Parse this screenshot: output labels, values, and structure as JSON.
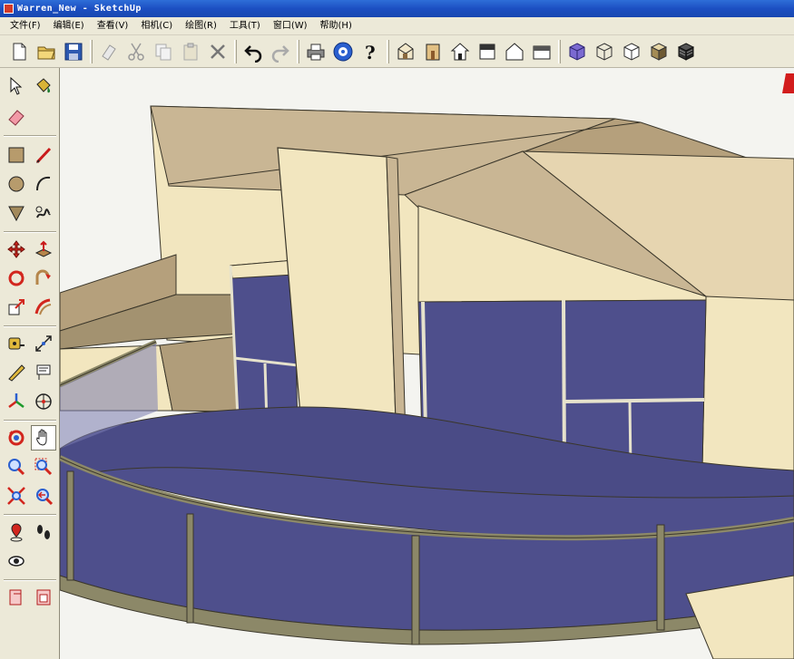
{
  "window": {
    "title": "Warren_New - SketchUp"
  },
  "menu": {
    "items": [
      "文件(F)",
      "编辑(E)",
      "查看(V)",
      "相机(C)",
      "绘图(R)",
      "工具(T)",
      "窗口(W)",
      "帮助(H)"
    ]
  },
  "toolbar": {
    "buttons": [
      "new-icon",
      "open-icon",
      "save-icon",
      "cut-icon",
      "copy-icon",
      "paste-icon",
      "erase-icon",
      "undo-icon",
      "redo-icon",
      "print-icon",
      "model-info-icon",
      "help-icon",
      "iso-view-icon",
      "top-view-icon",
      "front-view-icon",
      "right-view-icon",
      "back-view-icon",
      "left-view-icon",
      "xray-icon",
      "wireframe-icon",
      "hidden-line-icon",
      "shaded-icon",
      "textured-icon"
    ]
  },
  "palette": {
    "tools": [
      "select-icon",
      "paint-bucket-icon",
      "eraser-icon",
      "rectangle-icon",
      "line-icon",
      "circle-icon",
      "arc-icon",
      "polygon-icon",
      "freehand-icon",
      "move-icon",
      "push-pull-icon",
      "rotate-icon",
      "follow-me-icon",
      "scale-icon",
      "offset-icon",
      "tape-measure-icon",
      "dimension-icon",
      "protractor-icon",
      "text-icon",
      "axes-icon",
      "3d-text-icon",
      "orbit-icon",
      "pan-icon",
      "zoom-icon",
      "zoom-window-icon",
      "zoom-extents-icon",
      "previous-view-icon",
      "position-camera-icon",
      "walk-icon",
      "look-around-icon",
      "section-plane-icon",
      "section-display-icon",
      "section-cut-icon"
    ],
    "active_tool": "pan-icon"
  },
  "colors": {
    "wall": "#f2e6bf",
    "roof": "#c9b694",
    "roof_light": "#e6d5b0",
    "glass": "#4e4f8c",
    "glass_dark": "#3d3e78",
    "edge": "#3a362a",
    "rail": "#8c8868",
    "sky": "#f4f4f0",
    "axis_red": "#d21c1c"
  }
}
